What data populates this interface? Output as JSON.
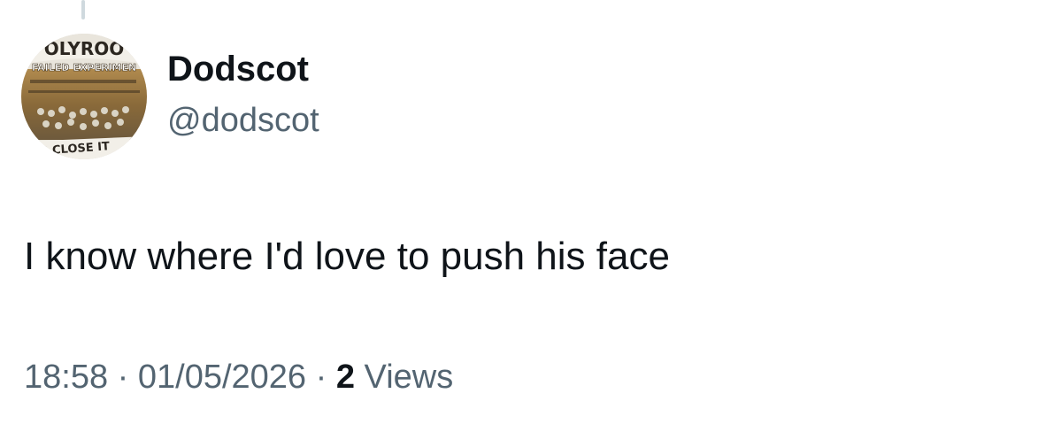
{
  "author": {
    "display_name": "Dodscot",
    "handle": "@dodscot",
    "avatar_text": {
      "top": "OLYROO",
      "middle": "FAILED EXPERIMEN",
      "bottom": "O CLOSE IT"
    }
  },
  "tweet": {
    "text": "I know where I'd love to push his face",
    "time": "18:58",
    "separator": "·",
    "date": "01/05/2026",
    "views_count": "2",
    "views_label": "Views"
  }
}
